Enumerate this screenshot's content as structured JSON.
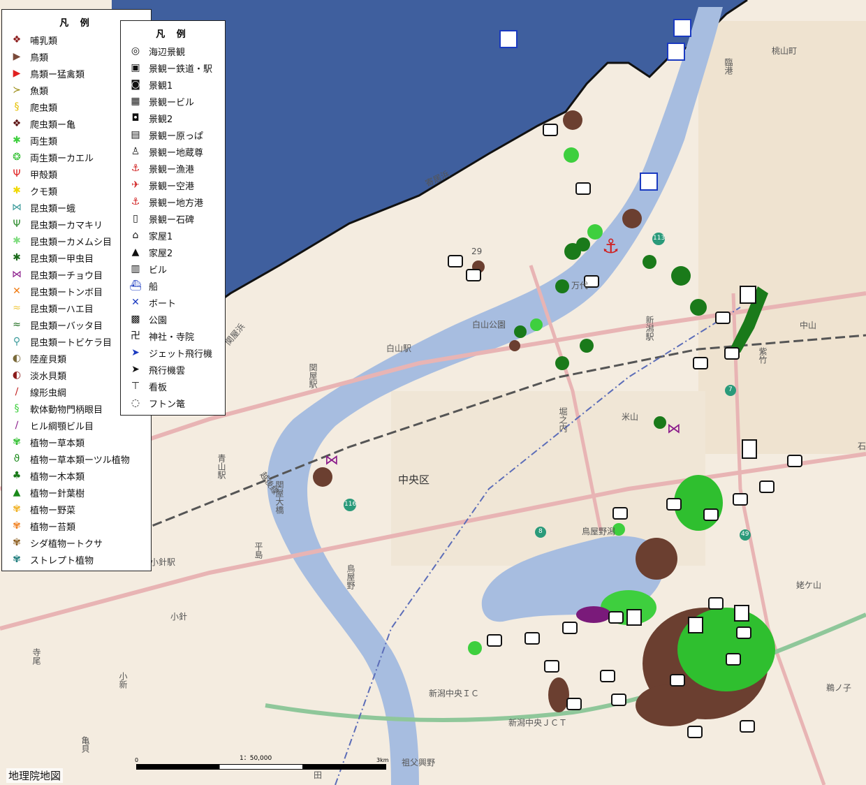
{
  "legend_primary": {
    "title": "凡 例",
    "items": [
      {
        "label": "哺乳類",
        "icon": "mammal-icon",
        "color": "#8b1a1a",
        "glyph": "❖"
      },
      {
        "label": "鳥類",
        "icon": "bird-icon",
        "color": "#7a4a3a",
        "glyph": "▶"
      },
      {
        "label": "鳥類ー猛禽類",
        "icon": "raptor-icon",
        "color": "#e02020",
        "glyph": "▶"
      },
      {
        "label": "魚類",
        "icon": "fish-icon",
        "color": "#9a8a10",
        "glyph": "≻"
      },
      {
        "label": "爬虫類",
        "icon": "reptile-icon",
        "color": "#e6c000",
        "glyph": "§"
      },
      {
        "label": "爬虫類ー亀",
        "icon": "turtle-icon",
        "color": "#5a1010",
        "glyph": "❖"
      },
      {
        "label": "両生類",
        "icon": "amphibian-icon",
        "color": "#3ecf3e",
        "glyph": "✱"
      },
      {
        "label": "両生類ーカエル",
        "icon": "frog-icon",
        "color": "#2fbf2f",
        "glyph": "❂"
      },
      {
        "label": "甲殻類",
        "icon": "crustacean-icon",
        "color": "#e02020",
        "glyph": "Ψ"
      },
      {
        "label": "クモ類",
        "icon": "spider-icon",
        "color": "#f0d800",
        "glyph": "✱"
      },
      {
        "label": "昆虫類ー蛾",
        "icon": "moth-icon",
        "color": "#3a9a9a",
        "glyph": "⋈"
      },
      {
        "label": "昆虫類ーカマキリ",
        "icon": "mantis-icon",
        "color": "#2a8a2a",
        "glyph": "Ψ"
      },
      {
        "label": "昆虫類ーカメムシ目",
        "icon": "stinkbug-icon",
        "color": "#7fdc7f",
        "glyph": "✱"
      },
      {
        "label": "昆虫類ー甲虫目",
        "icon": "beetle-icon",
        "color": "#1a6a1a",
        "glyph": "✱"
      },
      {
        "label": "昆虫類ーチョウ目",
        "icon": "butterfly-icon",
        "color": "#8a1a8a",
        "glyph": "⋈"
      },
      {
        "label": "昆虫類ートンボ目",
        "icon": "dragonfly-icon",
        "color": "#f07a10",
        "glyph": "✕"
      },
      {
        "label": "昆虫類ーハエ目",
        "icon": "fly-icon",
        "color": "#f0c840",
        "glyph": "≈"
      },
      {
        "label": "昆虫類ーバッタ目",
        "icon": "grasshopper-icon",
        "color": "#1a6a1a",
        "glyph": "≈"
      },
      {
        "label": "昆虫類ートビケラ目",
        "icon": "caddisfly-icon",
        "color": "#3a9a9a",
        "glyph": "⚲"
      },
      {
        "label": "陸産貝類",
        "icon": "land-snail-icon",
        "color": "#7a6a3a",
        "glyph": "◐"
      },
      {
        "label": "淡水貝類",
        "icon": "freshwater-shell-icon",
        "color": "#8b1a1a",
        "glyph": "◐"
      },
      {
        "label": "線形虫綱",
        "icon": "nematode-icon",
        "color": "#c02020",
        "glyph": "∕"
      },
      {
        "label": "軟体動物門柄眼目",
        "icon": "mollusk-icon",
        "color": "#3ecf3e",
        "glyph": "§"
      },
      {
        "label": "ヒル綱顎ビル目",
        "icon": "leech-icon",
        "color": "#8a1a8a",
        "glyph": "∕"
      },
      {
        "label": "植物ー草本類",
        "icon": "herb-icon",
        "color": "#2fbf2f",
        "glyph": "✾"
      },
      {
        "label": "植物ー草本類ーツル植物",
        "icon": "vine-icon",
        "color": "#1a8a1a",
        "glyph": "ϑ"
      },
      {
        "label": "植物ー木本類",
        "icon": "tree-icon",
        "color": "#1a7a1a",
        "glyph": "♣"
      },
      {
        "label": "植物ー針葉樹",
        "icon": "conifer-icon",
        "color": "#1a8a1a",
        "glyph": "▲"
      },
      {
        "label": "植物ー野菜",
        "icon": "vegetable-icon",
        "color": "#f0b020",
        "glyph": "✾"
      },
      {
        "label": "植物ー苔類",
        "icon": "moss-icon",
        "color": "#f08020",
        "glyph": "✾"
      },
      {
        "label": "シダ植物ートクサ",
        "icon": "horsetail-icon",
        "color": "#8a5a1a",
        "glyph": "✾"
      },
      {
        "label": "ストレプト植物",
        "icon": "streptophyte-icon",
        "color": "#1a7a7a",
        "glyph": "✾"
      }
    ]
  },
  "legend_secondary": {
    "title": "凡 例",
    "items": [
      {
        "label": "海辺景観",
        "icon": "seaside-icon",
        "color": "#111111",
        "glyph": "◎"
      },
      {
        "label": "景観ー鉄道・駅",
        "icon": "station-icon",
        "color": "#111111",
        "glyph": "▣"
      },
      {
        "label": "景観1",
        "icon": "camera-icon",
        "color": "#111111",
        "glyph": "◙"
      },
      {
        "label": "景観ービル",
        "icon": "building-icon",
        "color": "#111111",
        "glyph": "▦"
      },
      {
        "label": "景観2",
        "icon": "camera2-icon",
        "color": "#111111",
        "glyph": "◘"
      },
      {
        "label": "景観ー原っぱ",
        "icon": "field-icon",
        "color": "#111111",
        "glyph": "▤"
      },
      {
        "label": "景観ー地蔵尊",
        "icon": "jizo-icon",
        "color": "#111111",
        "glyph": "♙"
      },
      {
        "label": "景観ー漁港",
        "icon": "fishing-port-icon",
        "color": "#d02020",
        "glyph": "⚓"
      },
      {
        "label": "景観ー空港",
        "icon": "airport-icon",
        "color": "#d02020",
        "glyph": "✈"
      },
      {
        "label": "景観ー地方港",
        "icon": "local-port-icon",
        "color": "#d02020",
        "glyph": "⚓"
      },
      {
        "label": "景観ー石碑",
        "icon": "monument-icon",
        "color": "#111111",
        "glyph": "▯"
      },
      {
        "label": "家屋1",
        "icon": "house-icon",
        "color": "#111111",
        "glyph": "⌂"
      },
      {
        "label": "家屋2",
        "icon": "house2-icon",
        "color": "#111111",
        "glyph": "▲"
      },
      {
        "label": "ビル",
        "icon": "office-icon",
        "color": "#111111",
        "glyph": "▥"
      },
      {
        "label": "船",
        "icon": "ship-icon",
        "color": "#1a3ac0",
        "glyph": "⛴"
      },
      {
        "label": "ボート",
        "icon": "boat-icon",
        "color": "#1a3ac0",
        "glyph": "✕"
      },
      {
        "label": "公園",
        "icon": "park-icon",
        "color": "#111111",
        "glyph": "▩"
      },
      {
        "label": "神社・寺院",
        "icon": "shrine-icon",
        "color": "#111111",
        "glyph": "卍"
      },
      {
        "label": "ジェット飛行機",
        "icon": "jet-icon",
        "color": "#1a3ac0",
        "glyph": "➤"
      },
      {
        "label": "飛行機雲",
        "icon": "contrail-icon",
        "color": "#111111",
        "glyph": "➤"
      },
      {
        "label": "看板",
        "icon": "signboard-icon",
        "color": "#111111",
        "glyph": "⊤"
      },
      {
        "label": "フトン篭",
        "icon": "gabion-icon",
        "color": "#111111",
        "glyph": "◌"
      }
    ]
  },
  "place_labels": {
    "yorii": "寄居浜",
    "sekiya_hama": "関屋浜",
    "rinko": "臨港",
    "momoyama": "桃山町",
    "hakusan_park": "白山公園",
    "hakusan_station": "白山駅",
    "sekiya_station": "関屋駅",
    "niigata_station": "新潟駅",
    "shichiku": "紫竹",
    "nakayama": "中山",
    "yoneyama": "米山",
    "horinouchi": "堀之内",
    "chuo_ku": "中央区",
    "aoyama_station": "青山駅",
    "sekiya_bridge": "関屋大橋",
    "echigo_line": "越後線",
    "toyano_gata": "鳥屋野潟",
    "hiraito": "平島",
    "toyano": "鳥屋野",
    "kobari": "小針",
    "kobari_station": "小針駅",
    "terao": "寺尾",
    "kojin": "小新",
    "kamegai": "亀貝",
    "ubagayama": "姥ケ山",
    "tsurunoko": "鵜ノ子",
    "ichiban": "石",
    "niigata_chuo_ic": "新潟中央ＩＣ",
    "niigata_chuo_jct": "新潟中央ＪＣＴ",
    "sofu_kouya": "祖父興野",
    "den": "田",
    "route_29": "29",
    "route_113": "113",
    "route_116": "116",
    "route_8": "8",
    "route_7": "7",
    "route_49": "49",
    "bandai_bridge": "万代"
  },
  "scale": {
    "ratio": "1：50,000",
    "start": "0",
    "end": "3km"
  },
  "attribution": "地理院地図",
  "colors": {
    "sea": "#3f5f9e",
    "land": "#f4ece0",
    "river": "#a7bde0",
    "road": "#e8b4b4",
    "coast_line": "#111111"
  }
}
